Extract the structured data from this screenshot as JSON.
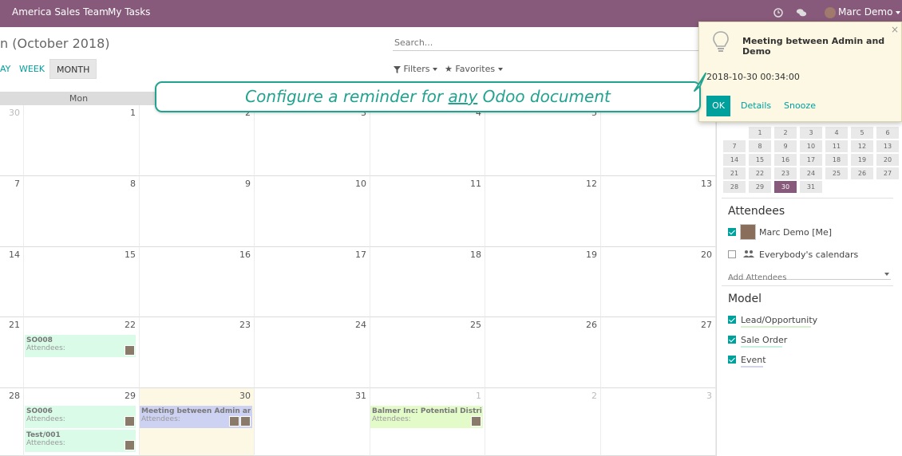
{
  "nav": {
    "menus": [
      "America Sales Team",
      "My Tasks"
    ],
    "user_name": "Marc Demo"
  },
  "control": {
    "title_partial": "n (October 2018)",
    "modes": [
      "AY",
      "WEEK",
      "MONTH"
    ],
    "active_mode": "MONTH",
    "search_placeholder": "Search...",
    "filters": "Filters",
    "favorites": "Favorites"
  },
  "calendar": {
    "day_header": "Mon",
    "rows": [
      [
        "30",
        "1",
        "2",
        "3",
        "4",
        "5",
        ""
      ],
      [
        "7",
        "8",
        "9",
        "10",
        "11",
        "12",
        "13"
      ],
      [
        "14",
        "15",
        "16",
        "17",
        "18",
        "19",
        "20"
      ],
      [
        "21",
        "22",
        "23",
        "24",
        "25",
        "26",
        "27"
      ],
      [
        "28",
        "29",
        "30",
        "31",
        "1",
        "2",
        "3"
      ]
    ],
    "events": {
      "so008": {
        "title": "SO008",
        "attendees": "Attendees:"
      },
      "so006": {
        "title": "SO006",
        "attendees": "Attendees:"
      },
      "test001": {
        "title": "Test/001",
        "attendees": "Attendees:"
      },
      "meeting": {
        "title": "Meeting between Admin and Der",
        "attendees": "Attendees:"
      },
      "balmer": {
        "title": "Balmer Inc: Potential Distributor",
        "attendees": "Attendees:"
      }
    }
  },
  "popover": {
    "title": "Meeting between Admin and Demo",
    "datetime": "2018-10-30 00:34:00",
    "ok": "OK",
    "details": "Details",
    "snooze": "Snooze",
    "close": "×"
  },
  "callout": {
    "before": "Configure a reminder for ",
    "emph": "any",
    "after": " Odoo document"
  },
  "sidebar": {
    "mini_days": [
      [
        "",
        "1",
        "2",
        "3",
        "4",
        "5",
        "6"
      ],
      [
        "7",
        "8",
        "9",
        "10",
        "11",
        "12",
        "13"
      ],
      [
        "14",
        "15",
        "16",
        "17",
        "18",
        "19",
        "20"
      ],
      [
        "21",
        "22",
        "23",
        "24",
        "25",
        "26",
        "27"
      ],
      [
        "28",
        "29",
        "30",
        "31",
        "",
        "",
        ""
      ]
    ],
    "attendees_title": "Attendees",
    "attendee_me": "Marc Demo [Me]",
    "everybody": "Everybody's calendars",
    "add_attendees_placeholder": "Add Attendees",
    "model_title": "Model",
    "models": [
      {
        "label": "Lead/Opportunity",
        "color": "#d8f0c8"
      },
      {
        "label": "Sale Order",
        "color": "#c8f0e0"
      },
      {
        "label": "Event",
        "color": "#d0d4f0"
      }
    ]
  },
  "colors": {
    "brand": "#875a7b",
    "accent": "#00a09d",
    "callout": "#21a38f",
    "event_green": "#d9fbe8",
    "event_blue": "#cdd2f3",
    "event_lime": "#e2fbc8",
    "today": "#fcf8e3"
  }
}
